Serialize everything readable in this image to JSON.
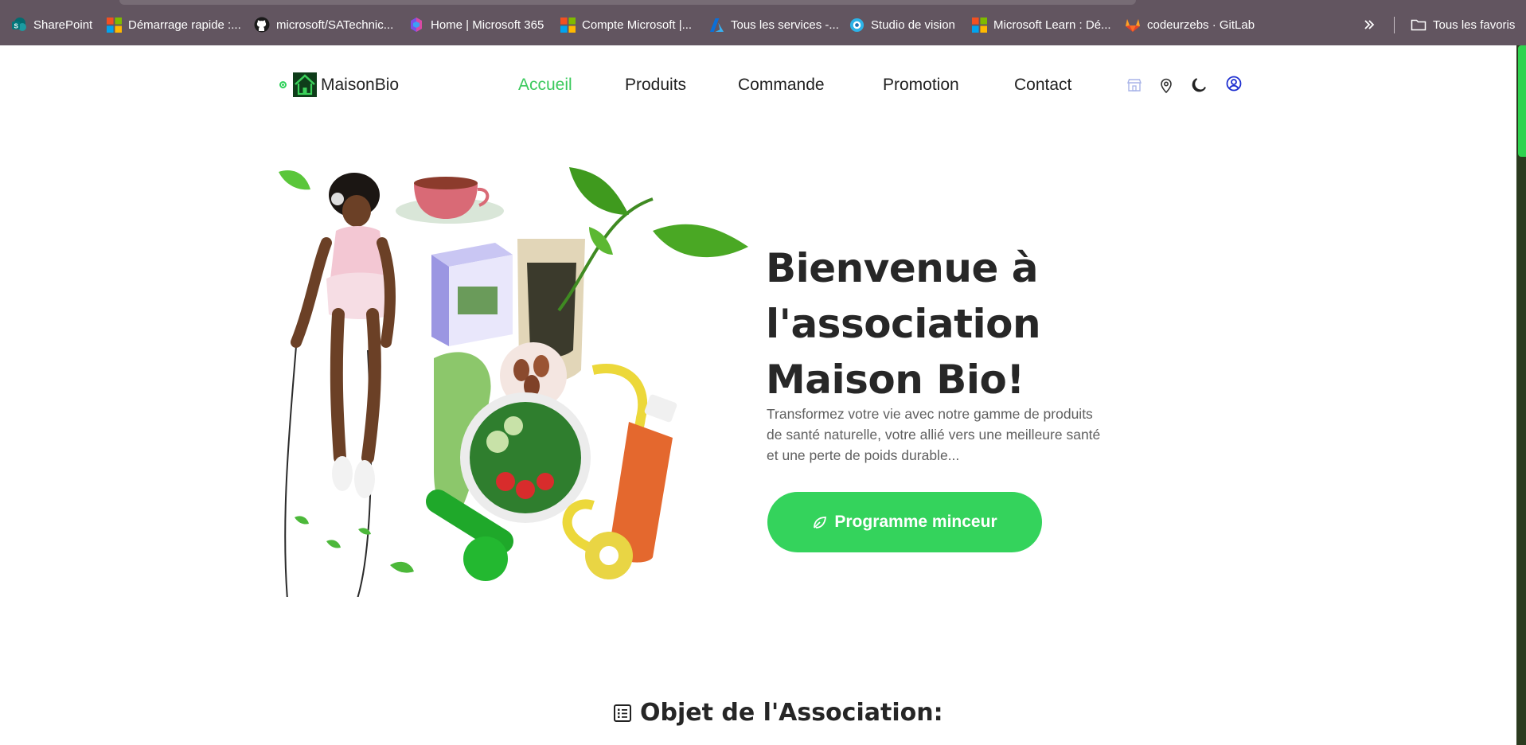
{
  "bookmarks": {
    "items": [
      {
        "label": "SharePoint",
        "icon": "sharepoint-icon"
      },
      {
        "label": "Démarrage rapide :...",
        "icon": "microsoft-icon"
      },
      {
        "label": "microsoft/SATechnic...",
        "icon": "github-icon"
      },
      {
        "label": "Home | Microsoft 365",
        "icon": "m365-icon"
      },
      {
        "label": "Compte Microsoft |...",
        "icon": "microsoft-icon"
      },
      {
        "label": "Tous les services -...",
        "icon": "azure-icon"
      },
      {
        "label": "Studio de vision",
        "icon": "vision-studio-icon"
      },
      {
        "label": "Microsoft Learn : Dé...",
        "icon": "microsoft-icon"
      },
      {
        "label": "codeurzebs · GitLab",
        "icon": "gitlab-icon"
      }
    ],
    "overflow_icon": "chevron-double-right-icon",
    "all_favorites": "Tous les favoris"
  },
  "nav": {
    "brand": "MaisonBio",
    "links": [
      "Accueil",
      "Produits",
      "Commande",
      "Promotion",
      "Contact"
    ],
    "active": "Accueil",
    "icons": [
      "store-icon",
      "location-pin-icon",
      "moon-icon",
      "user-circle-icon"
    ]
  },
  "hero": {
    "title": "Bienvenue à l'association Maison Bio!",
    "text": "Transformez votre vie avec notre gamme de produits de santé naturelle, votre allié vers une meilleure santé et une perte de poids durable...",
    "cta": "Programme minceur"
  },
  "section": {
    "title": "Objet de l'Association:"
  },
  "colors": {
    "accent": "#34d35c",
    "bookmarks_bg": "#625560",
    "title": "#272727"
  }
}
